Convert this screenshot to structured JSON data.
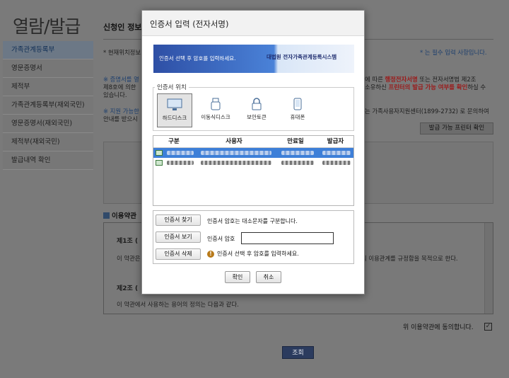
{
  "sidebar": {
    "title": "열람/발급",
    "items": [
      "가족관계등록부",
      "영문증명서",
      "제적부",
      "가족관계등록부(재외국민)",
      "영문증명서(재외국민)",
      "제적부(재외국민)",
      "발급내역 확인"
    ]
  },
  "main": {
    "title": "신청인 정보",
    "note_left": "* 현재위치정보",
    "note_right": "* 는 필수 입력 사항입니다.",
    "p1_left": "※ 증명서를 열",
    "p1_mid": "에 따른",
    "p1_red1": "행정전자서명",
    "p1_rest": "또는 전자서명법 제2조",
    "p2_left": "제8호에 의한",
    "p2_mid": "소유하신",
    "p2_red2": "프린터의 발급 가능 여부를 확인",
    "p2_rest": "하실 수",
    "p3": "있습니다.",
    "p4_left": "※ 지원 가능한",
    "p4_right": "는 가족사용자지원센터(1899-2732) 로 문의하여",
    "p5_left": "안내를 받으시",
    "printer_btn": "발급 가능 프린터 확인",
    "terms_title": "이용약관",
    "art1": "제1조 (",
    "art1_text": "이 약관은",
    "art1_text_r": "의 이용관계를 규정함을 목적으로 한다.",
    "art2": "제2조 (",
    "art2_text": "이 약관에서 사용하는 용어의 정의는 다음과 같다.",
    "agree": "위 이용약관에 동의합니다.",
    "agree_mark": "✓",
    "submit": "조회"
  },
  "modal": {
    "title": "인증서 입력 (전자서명)",
    "banner_text": "인증서 선택 후 암호를 입력하세요.",
    "banner_logo": "대법원 전자가족관계등록시스템",
    "location_label": "인증서 위치",
    "devices": [
      {
        "label": "하드디스크",
        "icon": "monitor-icon",
        "selected": true
      },
      {
        "label": "이동식디스크",
        "icon": "usb-icon",
        "selected": false
      },
      {
        "label": "보안토큰",
        "icon": "lock-icon",
        "selected": false
      },
      {
        "label": "휴대폰",
        "icon": "phone-icon",
        "selected": false
      }
    ],
    "columns": [
      "구분",
      "사용자",
      "만료일",
      "발급자"
    ],
    "find_btn": "인증서 찾기",
    "view_btn": "인증서 보기",
    "delete_btn": "인증서 삭제",
    "case_note": "인증서 암호는 대소문자를 구분합니다.",
    "pw_label": "인증서 암호",
    "warn_text": "인증서 선택 후 암호를 입력하세요.",
    "ok": "확인",
    "cancel": "취소"
  }
}
